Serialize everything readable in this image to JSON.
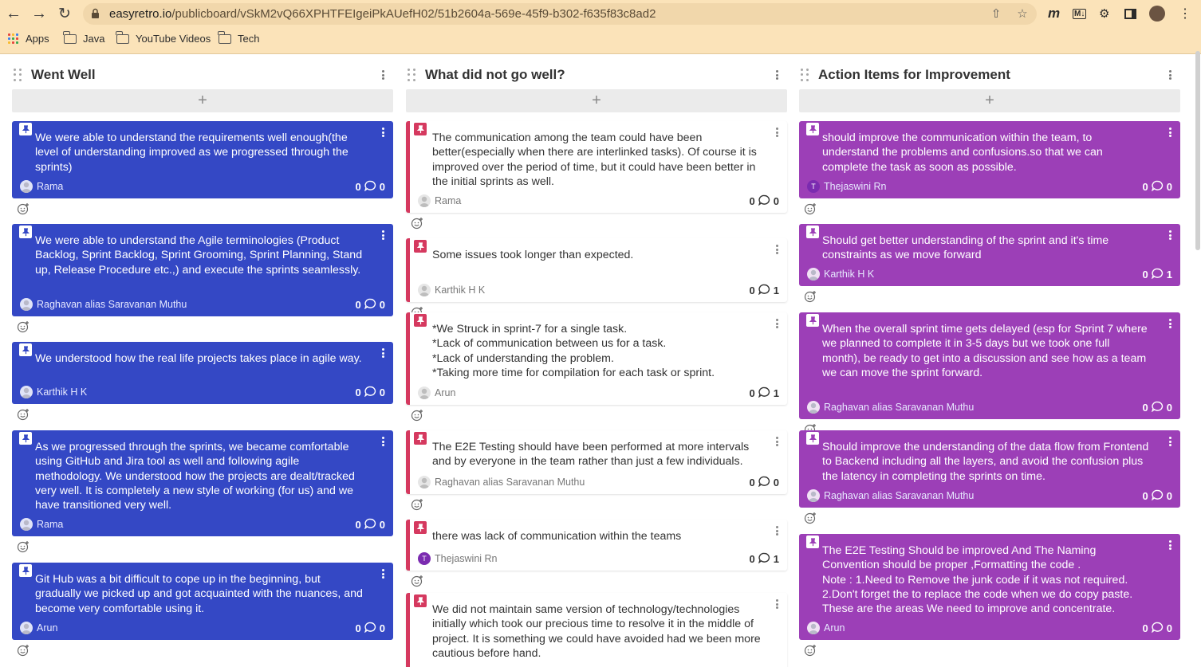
{
  "browser": {
    "url_host": "easyretro.io",
    "url_path": "/publicboard/vSkM2vQ66XPHTFEIgeiPkAUefH02/51b2604a-569e-45f9-b302-f635f83c8ad2",
    "bookmarks": [
      "Apps",
      "Java",
      "YouTube Videos",
      "Tech"
    ]
  },
  "columns": [
    {
      "title": "Went Well",
      "color": "#3448c5",
      "cards": [
        {
          "text": "We were able to understand the requirements well enough(the level of understanding improved as we progressed through the sprints)",
          "author": "Rama",
          "votes": "0",
          "comments": "0"
        },
        {
          "text": "We were able to understand the Agile terminologies (Product Backlog, Sprint Backlog, Sprint Grooming, Sprint Planning, Stand up, Release Procedure etc.,) and execute the sprints seamlessly.",
          "author": "Raghavan alias Saravanan Muthu",
          "votes": "0",
          "comments": "0"
        },
        {
          "text": "We understood how the real life projects takes place in agile way.",
          "author": "Karthik H K",
          "votes": "0",
          "comments": "0"
        },
        {
          "text": "As we progressed through the sprints, we became comfortable using GitHub and Jira tool as well and following agile methodology. We understood how the projects are dealt/tracked very well. It is completely a new style of working (for us) and we have transitioned very well.",
          "author": "Rama",
          "votes": "0",
          "comments": "0"
        },
        {
          "text": "Git Hub was a bit difficult to cope up in the beginning, but gradually we picked up and got acquainted with the nuances, and become very comfortable using it.",
          "author": "Arun",
          "votes": "0",
          "comments": "0"
        }
      ]
    },
    {
      "title": "What did not go well?",
      "color": "#d5395f",
      "cards": [
        {
          "text": "The communication among the team could have been better(especially when there are interlinked tasks). Of course it is improved over the period of time, but it could have been better in the initial sprints as well.",
          "author": "Rama",
          "votes": "0",
          "comments": "0"
        },
        {
          "text": "Some issues took longer than expected.",
          "author": "Karthik H K",
          "votes": "0",
          "comments": "1"
        },
        {
          "text": "*We Struck in sprint-7 for a single task.\n*Lack of communication between us for a task.\n*Lack of understanding the problem.\n*Taking more time for compilation for each task or sprint.",
          "author": "Arun",
          "votes": "0",
          "comments": "1"
        },
        {
          "text": "The E2E Testing should have been performed at more intervals and by everyone in the team rather than just a few individuals.",
          "author": "Raghavan alias Saravanan Muthu",
          "votes": "0",
          "comments": "0"
        },
        {
          "text": "there was lack of communication within the teams",
          "author": "Thejaswini Rn",
          "votes": "0",
          "comments": "1"
        },
        {
          "text": "We did not maintain same version of technology/technologies initially which took our precious time to resolve it in the middle of project. It is something we could have avoided had we been more cautious before hand.",
          "author": "",
          "votes": "",
          "comments": ""
        }
      ]
    },
    {
      "title": "Action Items for Improvement",
      "color": "#9c3fb7",
      "cards": [
        {
          "text": "should improve the communication within the team, to understand the problems and confusions.so that we can complete the task as soon as possible.",
          "author": "Thejaswini Rn",
          "votes": "0",
          "comments": "0"
        },
        {
          "text": "Should get better understanding of the sprint and it's time constraints as we move forward",
          "author": "Karthik H K",
          "votes": "0",
          "comments": "1"
        },
        {
          "text": "When the overall sprint time gets delayed (esp for Sprint 7 where we planned to complete it in 3-5 days but we took one full month), be ready to get into a discussion and see how as a team we can move the sprint forward.",
          "author": "Raghavan alias Saravanan Muthu",
          "votes": "0",
          "comments": "0"
        },
        {
          "text": "Should improve the understanding of the data flow from Frontend to Backend including all the layers, and avoid the confusion plus the latency in completing the sprints on time.",
          "author": "Raghavan alias Saravanan Muthu",
          "votes": "0",
          "comments": "0"
        },
        {
          "text": "The E2E Testing Should be improved And The Naming Convention should be proper ,Formatting the code .\nNote : 1.Need to Remove the junk code if it was not required.\n2.Don't forget the to replace the code when we do copy paste.\nThese are the areas We need to improve and concentrate.",
          "author": "Arun",
          "votes": "0",
          "comments": "0"
        }
      ]
    }
  ],
  "add_label": "+",
  "avatar_initial": "T"
}
